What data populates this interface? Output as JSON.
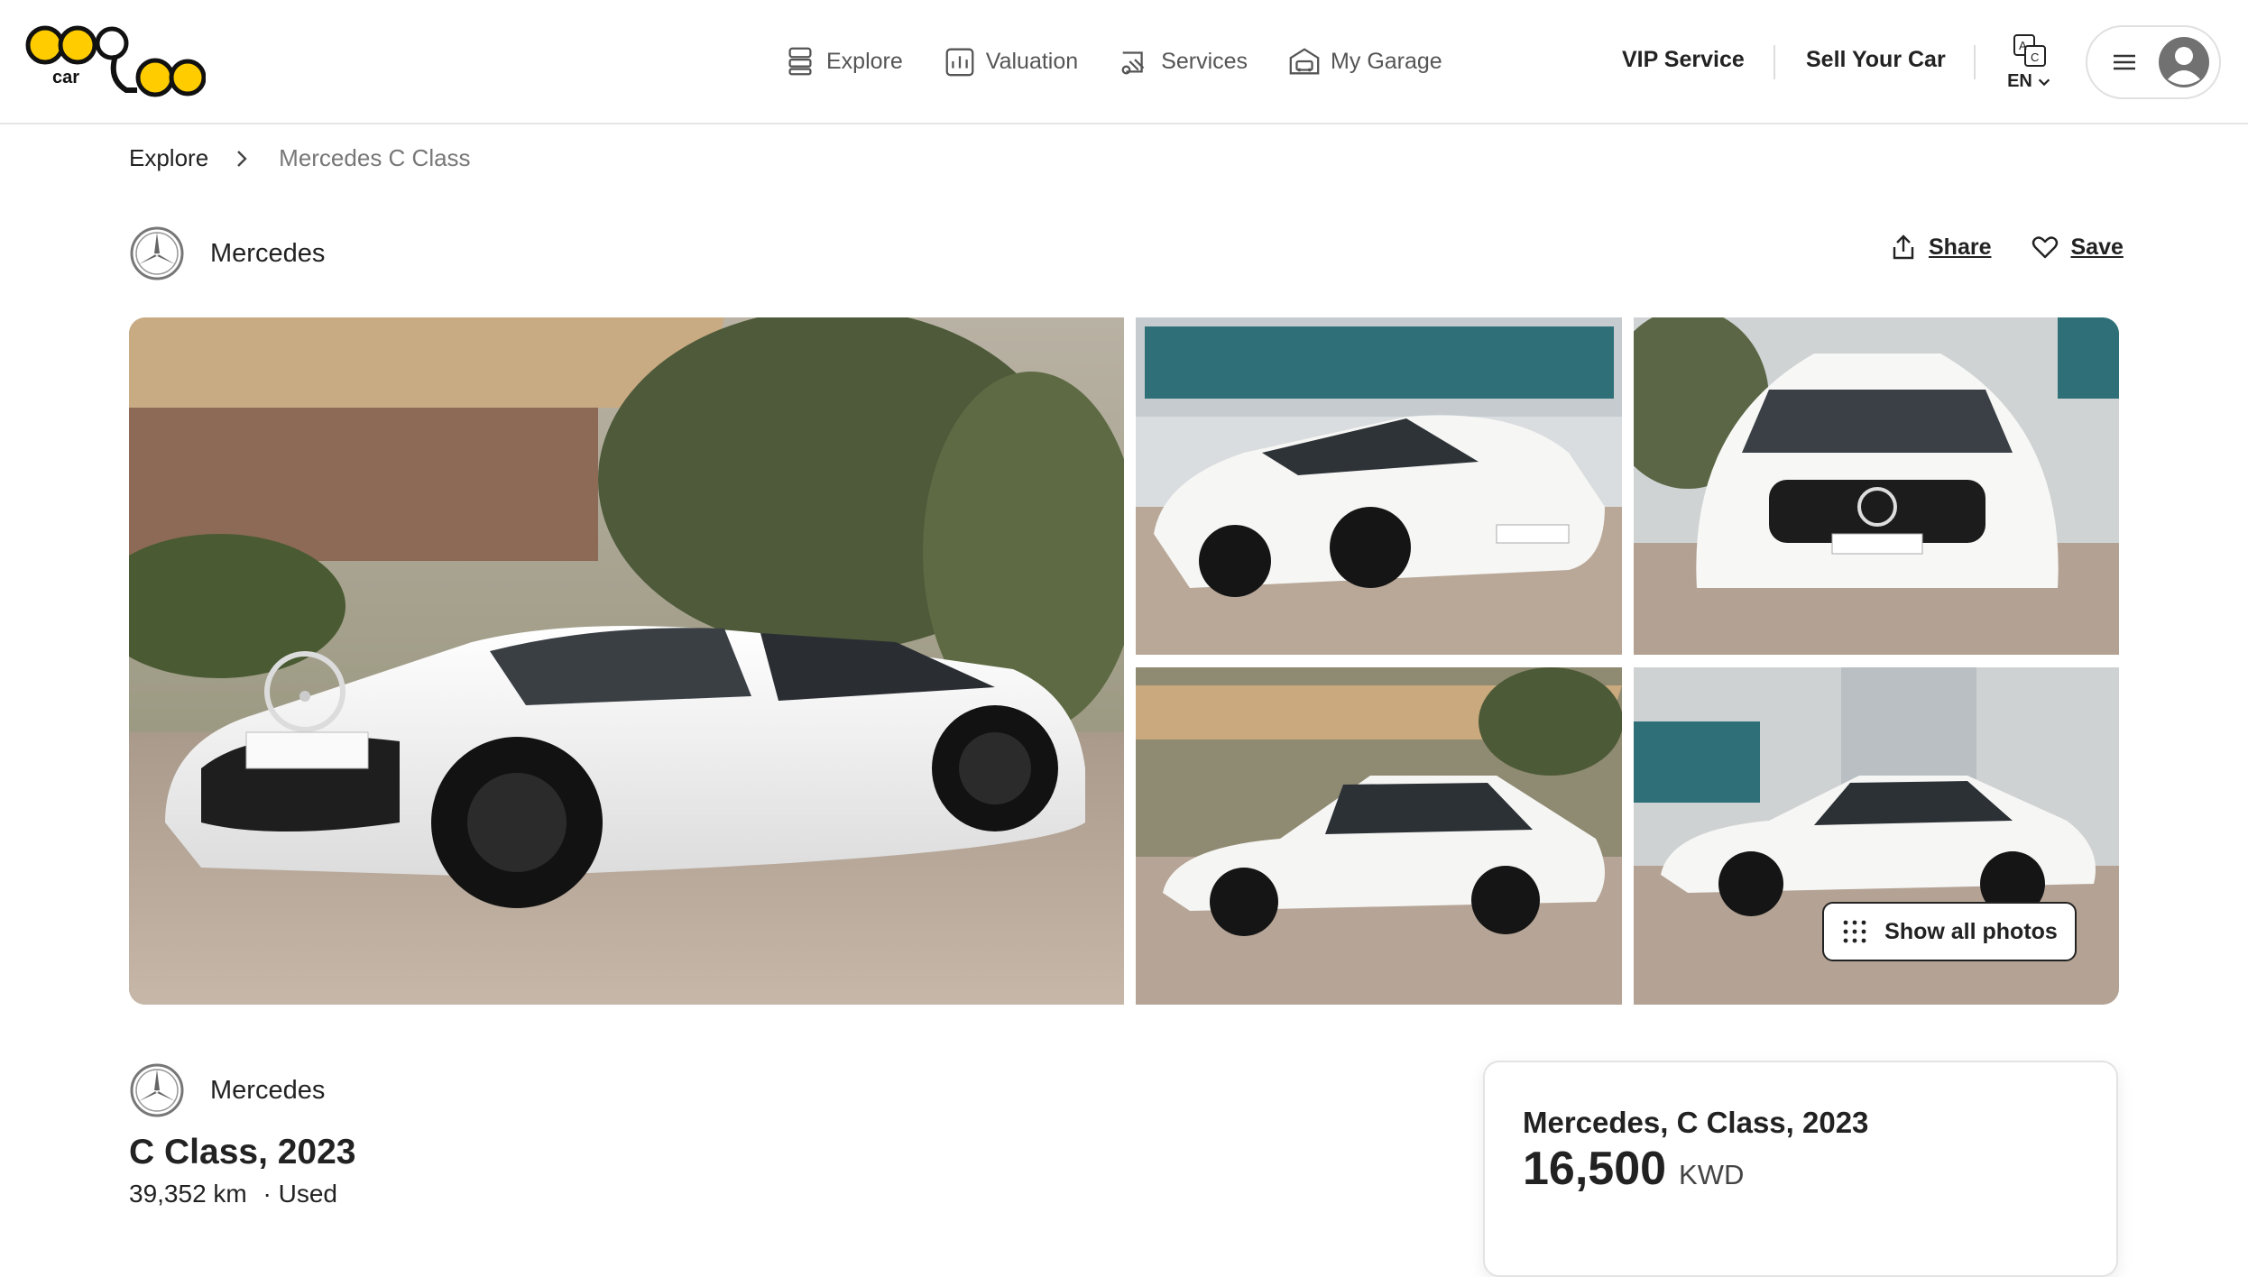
{
  "header": {
    "logo_text": "car",
    "nav": [
      {
        "label": "Explore",
        "icon": "explore-icon"
      },
      {
        "label": "Valuation",
        "icon": "valuation-icon"
      },
      {
        "label": "Services",
        "icon": "services-icon"
      },
      {
        "label": "My Garage",
        "icon": "garage-icon"
      }
    ],
    "vip_service": "VIP Service",
    "sell_your_car": "Sell Your Car",
    "language": "EN"
  },
  "breadcrumb": {
    "root": "Explore",
    "current": "Mercedes C Class"
  },
  "brand": {
    "name": "Mercedes"
  },
  "actions": {
    "share": "Share",
    "save": "Save"
  },
  "gallery": {
    "show_all": "Show all photos",
    "photo_count_shown": 5
  },
  "listing": {
    "brand": "Mercedes",
    "title": "C Class, 2023",
    "mileage": "39,352 km",
    "condition": "· Used"
  },
  "price_card": {
    "title": "Mercedes, C Class, 2023",
    "amount": "16,500",
    "currency": "KWD"
  },
  "colors": {
    "brand_yellow": "#FFCC00",
    "text_dark": "#222222",
    "text_muted": "#777777",
    "car_white": "#F4F4F2"
  }
}
